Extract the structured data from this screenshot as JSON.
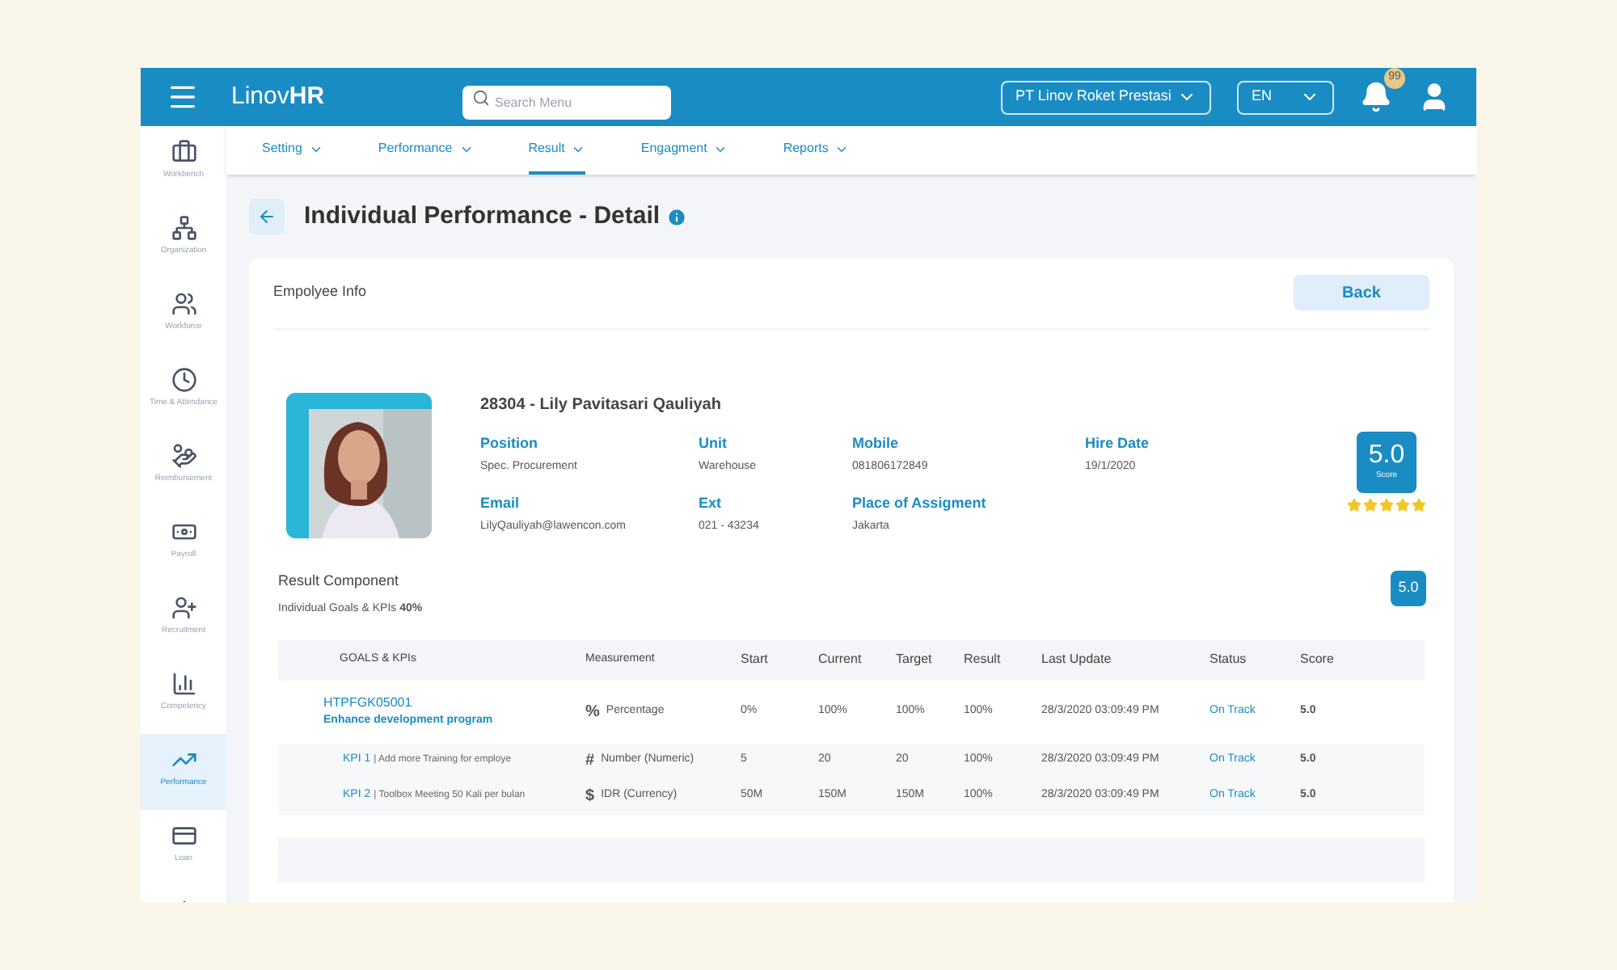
{
  "header": {
    "logo_light": "Linov",
    "logo_bold": "HR",
    "search": {
      "placeholder": "Search Menu"
    },
    "company": "PT Linov Roket Prestasi",
    "language": "EN",
    "notifications": "99"
  },
  "sidebar": {
    "items": [
      {
        "label": "Workbench",
        "selected": false
      },
      {
        "label": "Organization",
        "selected": false
      },
      {
        "label": "Workforce",
        "selected": false
      },
      {
        "label": "Time & Attendance",
        "selected": false
      },
      {
        "label": "Reimbursement",
        "selected": false
      },
      {
        "label": "Payroll",
        "selected": false
      },
      {
        "label": "Recruitment",
        "selected": false
      },
      {
        "label": "Competency",
        "selected": false
      },
      {
        "label": "Performance",
        "selected": true
      },
      {
        "label": "Loan",
        "selected": false
      },
      {
        "selected": false
      }
    ]
  },
  "tabs": [
    {
      "label": "Setting",
      "selected": false
    },
    {
      "label": "Performance",
      "selected": false
    },
    {
      "label": "Result",
      "selected": true
    },
    {
      "label": "Engagment",
      "selected": false
    },
    {
      "label": "Reports",
      "selected": false
    }
  ],
  "page": {
    "title": "Individual Performance - Detail"
  },
  "card": {
    "title": "Empolyee Info",
    "back": "Back"
  },
  "employee": {
    "name": "28304 - Lily Pavitasari Qauliyah",
    "fields": [
      {
        "label": "Position",
        "value": "Spec. Procurement"
      },
      {
        "label": "Unit",
        "value": "Warehouse"
      },
      {
        "label": "Mobile",
        "value": "081806172849"
      },
      {
        "label": "Hire Date",
        "value": "19/1/2020"
      },
      {
        "label": "Email",
        "value": "LilyQauliyah@lawencon.com"
      },
      {
        "label": "Ext",
        "value": "021 - 43234"
      },
      {
        "label": "Place of Assigment",
        "value": "Jakarta"
      }
    ],
    "score": "5.0",
    "score_label": "Score",
    "stars": 5
  },
  "result": {
    "title": "Result Component",
    "component": "Individual Goals & KPIs",
    "weight": "40%",
    "score": "5.0"
  },
  "table": {
    "columns": [
      "GOALS & KPIs",
      "Measurement",
      "Start",
      "Current",
      "Target",
      "Result",
      "Last Update",
      "Status",
      "Score"
    ],
    "rows": [
      {
        "kind": "goal",
        "code": "HTPFGK05001",
        "name": "Enhance development program",
        "symbol": "%",
        "measurement": "Percentage",
        "start": "0%",
        "current": "100%",
        "target": "100%",
        "result": "100%",
        "last_update": "28/3/2020 03:09:49 PM",
        "status": "On Track",
        "score": "5.0"
      },
      {
        "kind": "kpi",
        "code": "KPI 1",
        "name": "| Add more Training for employe",
        "symbol": "#",
        "measurement": "Number (Numeric)",
        "start": "5",
        "current": "20",
        "target": "20",
        "result": "100%",
        "last_update": "28/3/2020 03:09:49 PM",
        "status": "On Track",
        "score": "5.0"
      },
      {
        "kind": "kpi",
        "code": "KPI 2",
        "name": "| Toolbox Meeting 50 Kali per bulan",
        "symbol": "$",
        "measurement": "IDR (Currency)",
        "start": "50M",
        "current": "150M",
        "target": "150M",
        "result": "100%",
        "last_update": "28/3/2020 03:09:49 PM",
        "status": "On Track",
        "score": "5.0"
      }
    ]
  }
}
